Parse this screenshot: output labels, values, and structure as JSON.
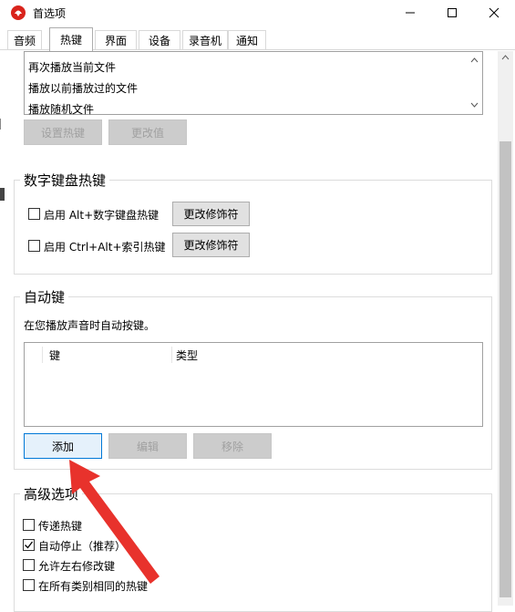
{
  "window": {
    "title": "首选项"
  },
  "tabs": [
    "音频",
    "热键",
    "界面",
    "设备",
    "录音机",
    "通知"
  ],
  "active_tab": "热键",
  "hotkey_list": [
    "再次播放当前文件",
    "播放以前播放过的文件",
    "播放随机文件"
  ],
  "hotkey_buttons": {
    "set": "设置热键",
    "change": "更改值"
  },
  "numpad": {
    "title": "数字键盘热键",
    "options": [
      {
        "label": "启用 Alt+数字键盘热键",
        "checked": false,
        "button": "更改修饰符"
      },
      {
        "label": "启用 Ctrl+Alt+索引热键",
        "checked": false,
        "button": "更改修饰符"
      }
    ]
  },
  "autokey": {
    "title": "自动键",
    "description": "在您播放声音时自动按键。",
    "columns": [
      "键",
      "类型"
    ],
    "buttons": {
      "add": "添加",
      "edit": "编辑",
      "remove": "移除"
    }
  },
  "advanced": {
    "title": "高级选项",
    "options": [
      {
        "label": "传递热键",
        "checked": false
      },
      {
        "label": "自动停止（推荐）",
        "checked": true
      },
      {
        "label": "允许左右修改键",
        "checked": false
      },
      {
        "label": "在所有类别相同的热键",
        "checked": false
      }
    ]
  },
  "colors": {
    "annotation_arrow": "#e8322c",
    "focus": "#0078d7"
  }
}
